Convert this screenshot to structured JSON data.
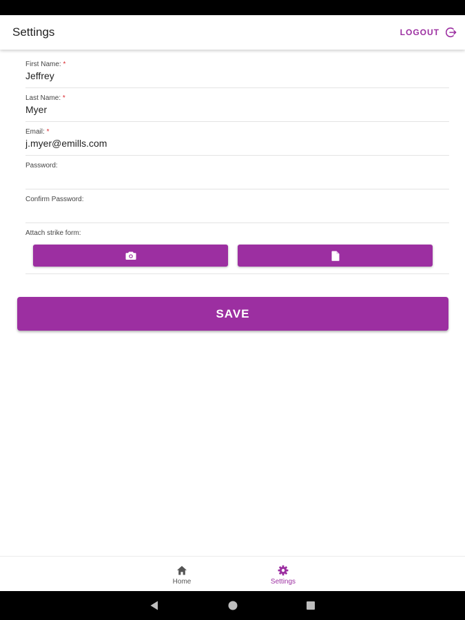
{
  "appbar": {
    "title": "Settings",
    "logout_label": "LOGOUT",
    "logout_icon": "logout-icon"
  },
  "form": {
    "first_name": {
      "label": "First Name:",
      "required": "*",
      "value": "Jeffrey"
    },
    "last_name": {
      "label": "Last Name:",
      "required": "*",
      "value": "Myer"
    },
    "email": {
      "label": "Email:",
      "required": "*",
      "value": "j.myer@emills.com"
    },
    "password": {
      "label": "Password:",
      "value": ""
    },
    "confirm_password": {
      "label": "Confirm Password:",
      "value": ""
    },
    "attach": {
      "label": "Attach strike form:",
      "camera_icon": "camera-icon",
      "file_icon": "file-icon"
    }
  },
  "save_label": "SAVE",
  "bottom_nav": {
    "items": [
      {
        "label": "Home",
        "icon": "home-icon",
        "active": false
      },
      {
        "label": "Settings",
        "icon": "gear-icon",
        "active": true
      }
    ]
  },
  "colors": {
    "accent": "#9c2fa1",
    "required": "#d9262c"
  }
}
